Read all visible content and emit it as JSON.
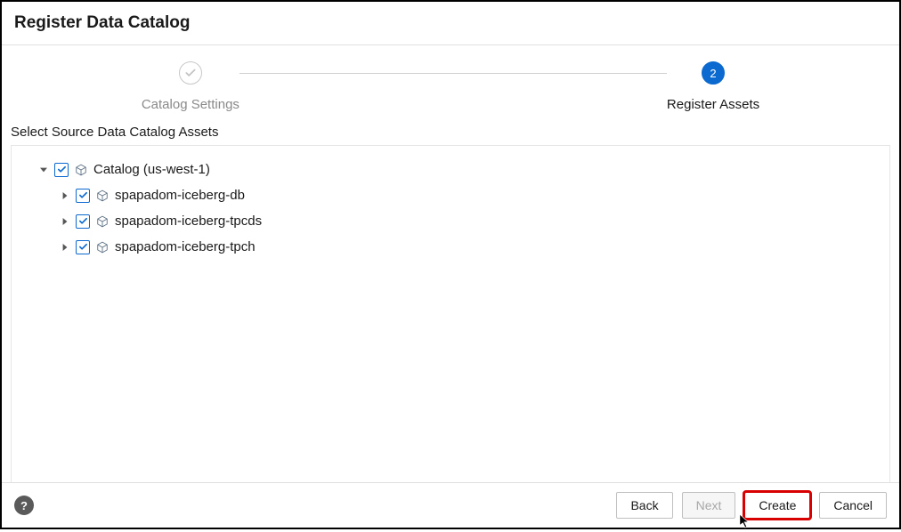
{
  "header": {
    "title": "Register Data Catalog"
  },
  "stepper": {
    "step1": {
      "label": "Catalog Settings"
    },
    "step2": {
      "number": "2",
      "label": "Register Assets"
    }
  },
  "section_label": "Select Source Data Catalog Assets",
  "tree": {
    "root": {
      "label": "Catalog (us-west-1)"
    },
    "children": [
      {
        "label": "spapadom-iceberg-db"
      },
      {
        "label": "spapadom-iceberg-tpcds"
      },
      {
        "label": "spapadom-iceberg-tpch"
      }
    ]
  },
  "footer": {
    "help": "?",
    "back": "Back",
    "next": "Next",
    "create": "Create",
    "cancel": "Cancel"
  }
}
